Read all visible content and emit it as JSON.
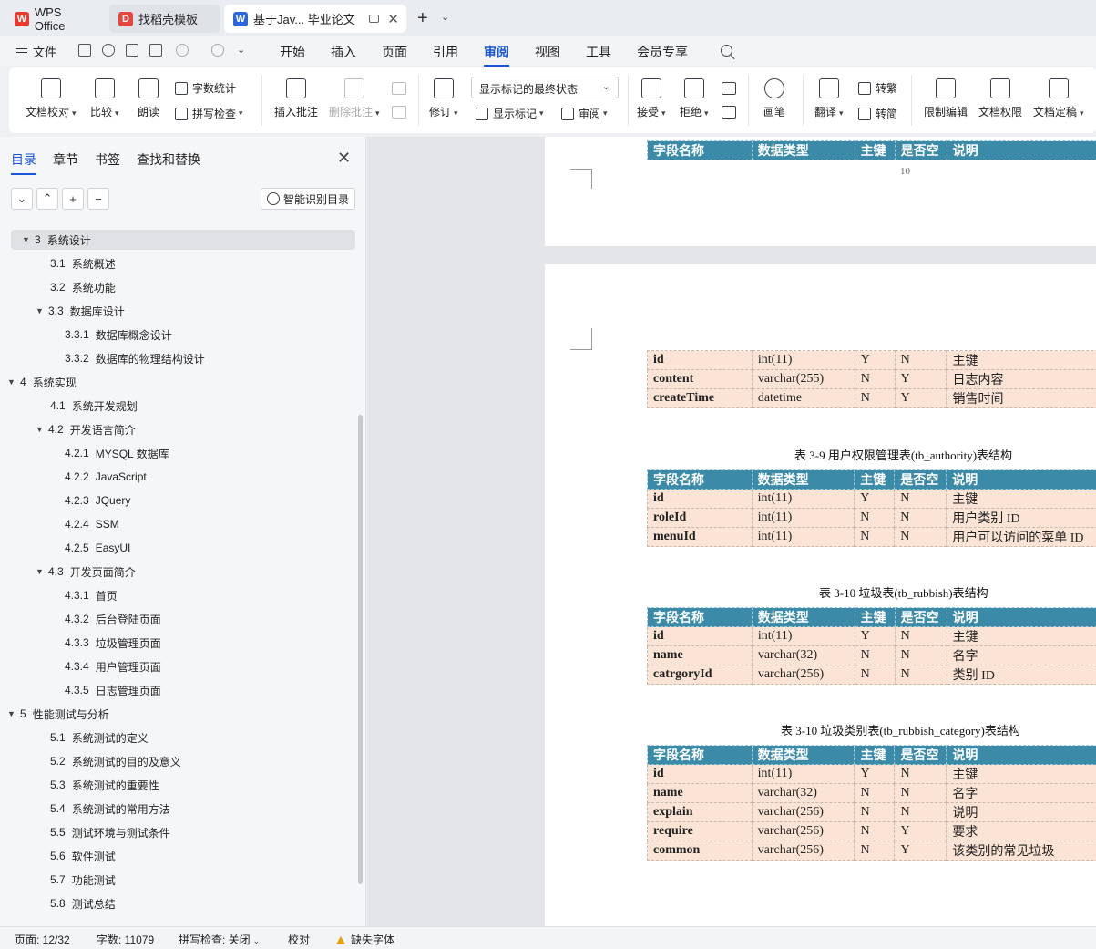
{
  "tabs": [
    {
      "label": "WPS Office",
      "logo": "W"
    },
    {
      "label": "找稻壳模板",
      "logo": "D"
    },
    {
      "label": "基于Jav... 毕业论文",
      "logo": "W"
    }
  ],
  "menubar": {
    "file": "文件",
    "items": [
      "开始",
      "插入",
      "页面",
      "引用",
      "审阅",
      "视图",
      "工具",
      "会员专享"
    ],
    "active": "审阅"
  },
  "ribbon": {
    "doc_check": "文档校对",
    "compare": "比较",
    "read_aloud": "朗读",
    "word_count": "字数统计",
    "spell_check": "拼写检查",
    "insert_comment": "插入批注",
    "delete_comment": "删除批注",
    "revise": "修订",
    "show_state": "显示标记的最终状态",
    "show_marks": "显示标记",
    "review": "审阅",
    "accept": "接受",
    "reject": "拒绝",
    "pen": "画笔",
    "translate": "翻译",
    "to_trad": "转繁",
    "to_simp": "转简",
    "restrict_edit": "限制编辑",
    "doc_rights": "文档权限",
    "doc_final": "文档定稿"
  },
  "panel": {
    "tabs": [
      "目录",
      "章节",
      "书签",
      "查找和替换"
    ],
    "smart_toc": "智能识别目录",
    "toc": [
      {
        "num": "3",
        "title": "系统设计",
        "level": 1,
        "arrow": "▼",
        "selected": true
      },
      {
        "num": "3.1",
        "title": "系统概述",
        "level": 2
      },
      {
        "num": "3.2",
        "title": "系统功能",
        "level": 2
      },
      {
        "num": "3.3",
        "title": "数据库设计",
        "level": 2,
        "arrow": "▼"
      },
      {
        "num": "3.3.1",
        "title": "数据库概念设计",
        "level": 3
      },
      {
        "num": "3.3.2",
        "title": "数据库的物理结构设计",
        "level": 3
      },
      {
        "num": "4",
        "title": "系统实现",
        "level": 1,
        "arrow": "▼"
      },
      {
        "num": "4.1",
        "title": "系统开发规划",
        "level": 2
      },
      {
        "num": "4.2",
        "title": "开发语言简介",
        "level": 2,
        "arrow": "▼"
      },
      {
        "num": "4.2.1",
        "title": "MYSQL 数据库",
        "level": 3
      },
      {
        "num": "4.2.2",
        "title": "JavaScript",
        "level": 3
      },
      {
        "num": "4.2.3",
        "title": "JQuery",
        "level": 3
      },
      {
        "num": "4.2.4",
        "title": "SSM",
        "level": 3
      },
      {
        "num": "4.2.5",
        "title": "EasyUI",
        "level": 3
      },
      {
        "num": "4.3",
        "title": "开发页面简介",
        "level": 2,
        "arrow": "▼"
      },
      {
        "num": "4.3.1",
        "title": "首页",
        "level": 3
      },
      {
        "num": "4.3.2",
        "title": "后台登陆页面",
        "level": 3
      },
      {
        "num": "4.3.3",
        "title": "垃圾管理页面",
        "level": 3
      },
      {
        "num": "4.3.4",
        "title": "用户管理页面",
        "level": 3
      },
      {
        "num": "4.3.5",
        "title": "日志管理页面",
        "level": 3
      },
      {
        "num": "5",
        "title": "性能测试与分析",
        "level": 1,
        "arrow": "▼"
      },
      {
        "num": "5.1",
        "title": "系统测试的定义",
        "level": 2
      },
      {
        "num": "5.2",
        "title": "系统测试的目的及意义",
        "level": 2
      },
      {
        "num": "5.3",
        "title": "系统测试的重要性",
        "level": 2
      },
      {
        "num": "5.4",
        "title": "系统测试的常用方法",
        "level": 2
      },
      {
        "num": "5.5",
        "title": "测试环境与测试条件",
        "level": 2
      },
      {
        "num": "5.6",
        "title": "软件测试",
        "level": 2
      },
      {
        "num": "5.7",
        "title": "功能测试",
        "level": 2
      },
      {
        "num": "5.8",
        "title": "测试总结",
        "level": 2
      }
    ]
  },
  "document": {
    "headers": [
      "字段名称",
      "数据类型",
      "主键",
      "是否空",
      "说明"
    ],
    "page_number": "10",
    "table_log": [
      [
        "id",
        "int(11)",
        "Y",
        "N",
        "主键"
      ],
      [
        "content",
        "varchar(255)",
        "N",
        "Y",
        "日志内容"
      ],
      [
        "createTime",
        "datetime",
        "N",
        "Y",
        "销售时间"
      ]
    ],
    "caption_authority": "表 3-9 用户权限管理表(tb_authority)表结构",
    "table_authority": [
      [
        "id",
        "int(11)",
        "Y",
        "N",
        "主键"
      ],
      [
        "roleId",
        "int(11)",
        "N",
        "N",
        "用户类别 ID"
      ],
      [
        "menuId",
        "int(11)",
        "N",
        "N",
        "用户可以访问的菜单 ID"
      ]
    ],
    "caption_rubbish": "表 3-10  垃圾表(tb_rubbish)表结构",
    "table_rubbish": [
      [
        "id",
        "int(11)",
        "Y",
        "N",
        "主键"
      ],
      [
        "name",
        "varchar(32)",
        "N",
        "N",
        "名字"
      ],
      [
        "catrgoryId",
        "varchar(256)",
        "N",
        "N",
        "类别 ID"
      ]
    ],
    "caption_category": "表 3-10  垃圾类别表(tb_rubbish_category)表结构",
    "table_category": [
      [
        "id",
        "int(11)",
        "Y",
        "N",
        "主键"
      ],
      [
        "name",
        "varchar(32)",
        "N",
        "N",
        "名字"
      ],
      [
        "explain",
        "varchar(256)",
        "N",
        "N",
        "说明"
      ],
      [
        "require",
        "varchar(256)",
        "N",
        "Y",
        "要求"
      ],
      [
        "common",
        "varchar(256)",
        "N",
        "Y",
        "该类别的常见垃圾"
      ]
    ]
  },
  "status": {
    "page": "页面: 12/32",
    "words": "字数: 11079",
    "spell": "拼写检查: 关闭",
    "proof": "校对",
    "missing_font": "缺失字体"
  },
  "colors": {
    "accent": "#1a56d6",
    "table_header": "#3a8aa8",
    "table_cell": "#fbe4d5"
  }
}
